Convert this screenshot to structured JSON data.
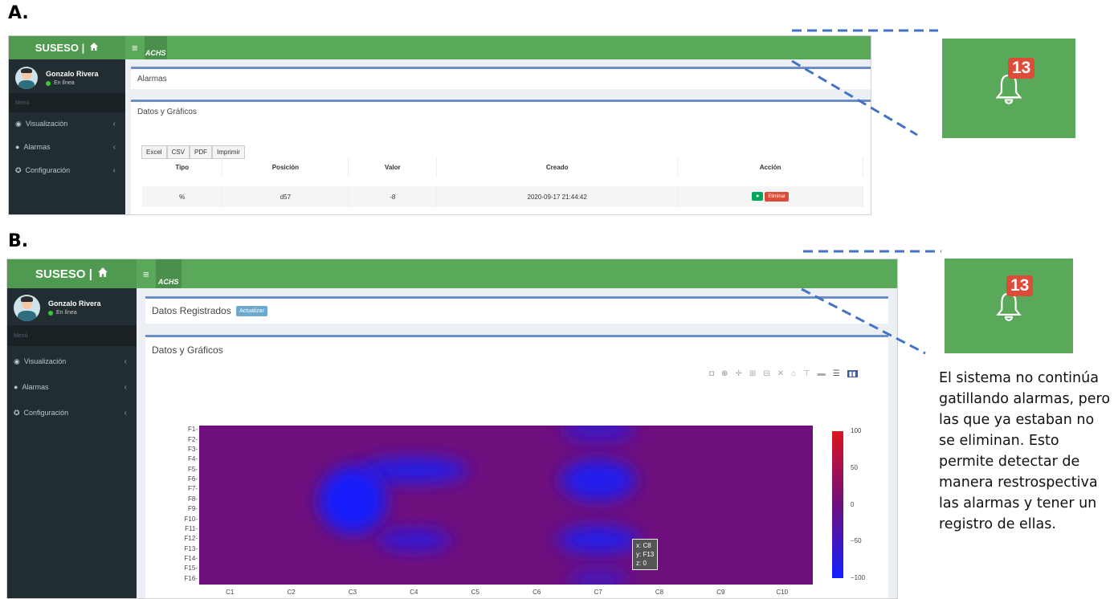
{
  "figure": {
    "label_a": "A.",
    "label_b": "B."
  },
  "app": {
    "brand": "SUSESO |",
    "logo": "ACHS",
    "user_name": "Gonzalo Rivera",
    "user_status": "En línea",
    "menu_header": "Menú",
    "menu": [
      {
        "label": "Visualización",
        "icon": "dashboard-icon"
      },
      {
        "label": "Alarmas",
        "icon": "alert-icon"
      },
      {
        "label": "Configuración",
        "icon": "cog-icon"
      }
    ],
    "notif_count": "13"
  },
  "panel_a": {
    "breadcrumb": "Alarmas",
    "section_title": "Datos y Gráficos",
    "export_buttons": [
      "Excel",
      "CSV",
      "PDF",
      "Imprimir"
    ],
    "table": {
      "columns": [
        "Tipo",
        "Posición",
        "Valor",
        "Creado",
        "Acción"
      ],
      "rows": [
        {
          "tipo": "%",
          "posicion": "d57",
          "valor": "-8",
          "creado": "2020-09-17 21:44:42"
        }
      ],
      "delete_label": "Eliminar"
    }
  },
  "panel_b": {
    "page_title": "Datos Registrados",
    "update_button": "Actualizar",
    "section_title": "Datos y Gráficos"
  },
  "zoom": {
    "badge": "13"
  },
  "annotation": "El sistema no continúa gatillando alarmas, pero las que ya estaban no se eliminan. Esto permite detectar de manera restrospectiva las alarmas y tener un registro de ellas.",
  "chart_data": {
    "type": "heatmap",
    "x": [
      "C1",
      "C2",
      "C3",
      "C4",
      "C5",
      "C6",
      "C7",
      "C8",
      "C9",
      "C10"
    ],
    "y": [
      "F1",
      "F2",
      "F3",
      "F4",
      "F5",
      "F6",
      "F7",
      "F8",
      "F9",
      "F10",
      "F11",
      "F12",
      "F13",
      "F14",
      "F15",
      "F16"
    ],
    "zlim": [
      -100,
      100
    ],
    "colorbar_ticks": [
      "100",
      "50",
      "0",
      "−50",
      "−100"
    ],
    "blobs": [
      {
        "x": "C7",
        "y": "F1",
        "z": -55
      },
      {
        "x": "C4",
        "y": "F5",
        "z": -80
      },
      {
        "x": "C3",
        "y": "F8",
        "z": -95
      },
      {
        "x": "C7",
        "y": "F6",
        "z": -85
      },
      {
        "x": "C4",
        "y": "F12",
        "z": -65
      },
      {
        "x": "C7",
        "y": "F12",
        "z": -80
      },
      {
        "x": "C7",
        "y": "F16",
        "z": -45
      }
    ],
    "background_z": 0,
    "hover": {
      "x": "x: C8",
      "y": "y: F13",
      "z": "z: 0"
    }
  }
}
